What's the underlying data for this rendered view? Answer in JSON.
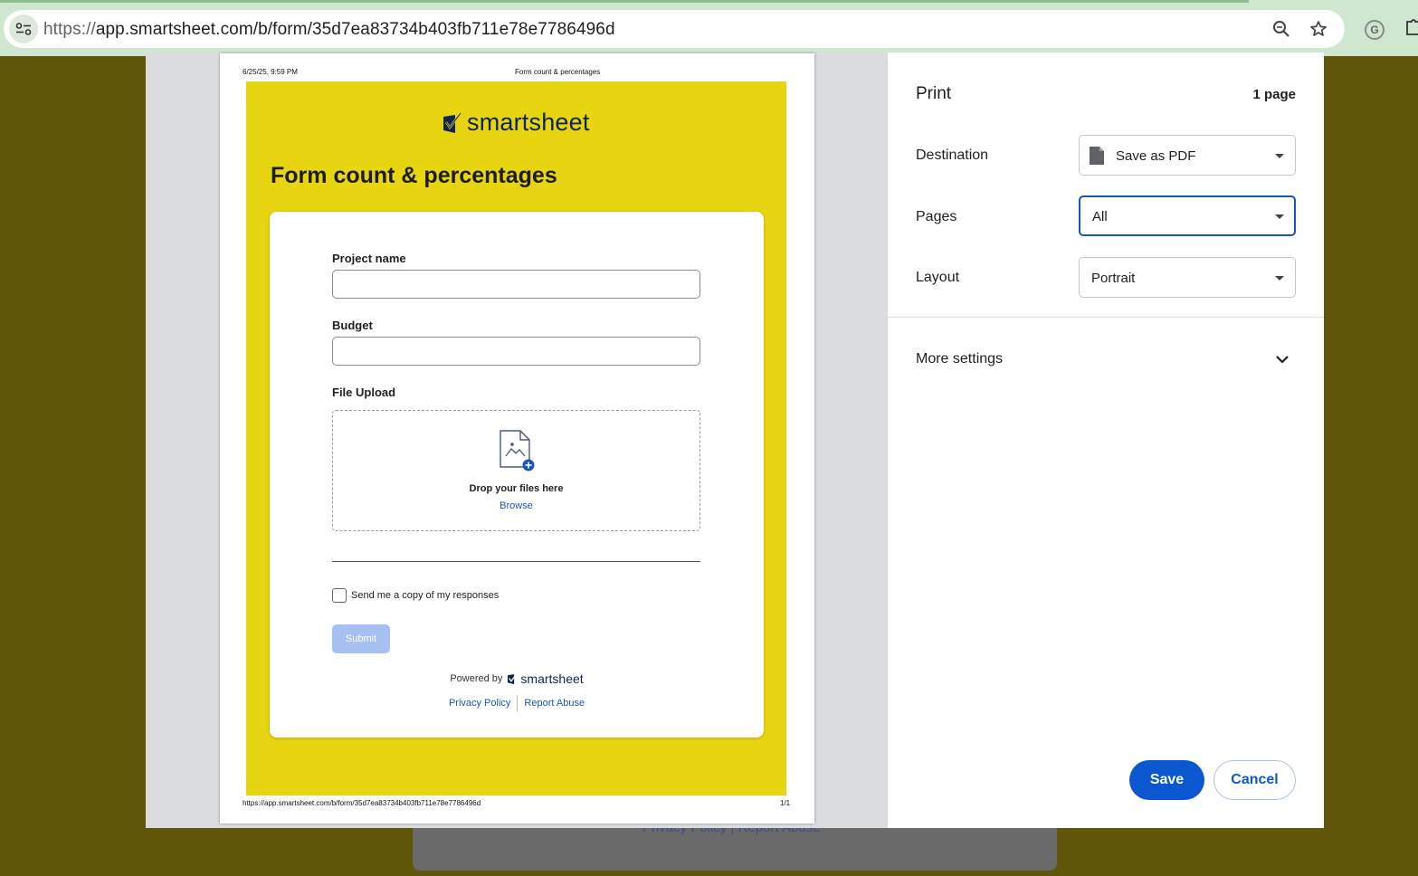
{
  "browser": {
    "url_protocol": "https://",
    "url_rest": "app.smartsheet.com/b/form/35d7ea83734b403fb711e78e7786496d",
    "icons": [
      "site-settings-icon",
      "zoom-icon",
      "bookmark-star-icon",
      "grammarly-extension-icon",
      "extensions-puzzle-icon"
    ]
  },
  "background_page": {
    "links_text": "Privacy Policy  |  Report Abuse"
  },
  "preview": {
    "header_date": "6/25/25, 9:59 PM",
    "header_title": "Form count & percentages",
    "footer_url": "https://app.smartsheet.com/b/form/35d7ea83734b403fb711e78e7786496d",
    "footer_page": "1/1",
    "brand_name": "smartsheet",
    "form_title": "Form count & percentages",
    "fields": {
      "project_name_label": "Project name",
      "budget_label": "Budget",
      "file_upload_label": "File Upload"
    },
    "dropzone": {
      "text": "Drop your files here",
      "browse": "Browse"
    },
    "checkbox_label": "Send me a copy of my responses",
    "submit_label": "Submit",
    "powered_by": "Powered by",
    "powered_brand": "smartsheet",
    "privacy_policy": "Privacy Policy",
    "report_abuse": "Report Abuse",
    "colors": {
      "form_background": "#e7d512",
      "brand_navy": "#0d2552",
      "link_blue": "#1a56b5"
    }
  },
  "settings": {
    "title": "Print",
    "page_count": "1 page",
    "destination_label": "Destination",
    "destination_value": "Save as PDF",
    "pages_label": "Pages",
    "pages_value": "All",
    "layout_label": "Layout",
    "layout_value": "Portrait",
    "more_settings": "More settings",
    "save_label": "Save",
    "cancel_label": "Cancel",
    "colors": {
      "primary": "#0b57d0"
    }
  }
}
